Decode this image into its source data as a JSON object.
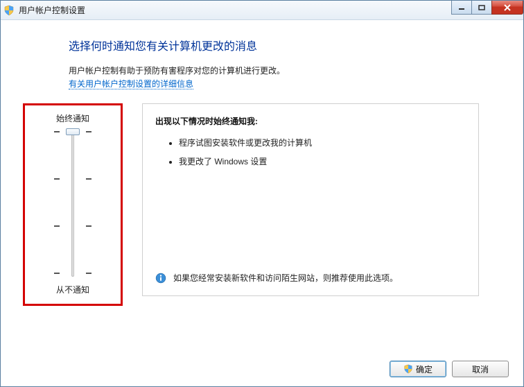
{
  "window": {
    "title": "用户帐户控制设置"
  },
  "heading": "选择何时通知您有关计算机更改的消息",
  "subtext_line1": "用户帐户控制有助于预防有害程序对您的计算机进行更改。",
  "subtext_link": "有关用户帐户控制设置的详细信息",
  "slider": {
    "top_label": "始终通知",
    "bottom_label": "从不通知"
  },
  "panel": {
    "title": "出现以下情况时始终通知我:",
    "items": [
      "程序试图安装软件或更改我的计算机",
      "我更改了 Windows 设置"
    ],
    "recommend": "如果您经常安装新软件和访问陌生网站，则推荐使用此选项。"
  },
  "buttons": {
    "ok": "确定",
    "cancel": "取消"
  }
}
